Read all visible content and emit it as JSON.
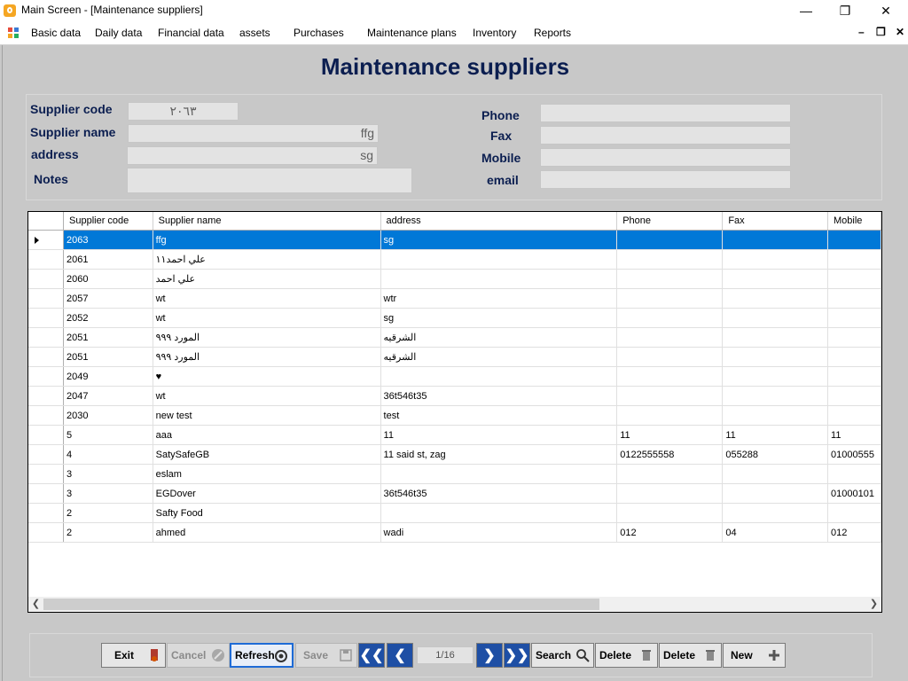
{
  "window": {
    "title": "Main Screen - [Maintenance suppliers]"
  },
  "menu": [
    "Basic data",
    "Daily data",
    "Financial data",
    "assets",
    "Purchases",
    "Maintenance plans",
    "Inventory",
    "Reports"
  ],
  "form": {
    "heading": "Maintenance suppliers",
    "labels": {
      "supplier_code": "Supplier code",
      "supplier_name": "Supplier name",
      "address": "address",
      "notes": "Notes",
      "phone": "Phone",
      "fax": "Fax",
      "mobile": "Mobile",
      "email": "email"
    },
    "values": {
      "supplier_code": "٢٠٦٣",
      "supplier_name": "ffg",
      "address": "sg",
      "notes": "",
      "phone": "",
      "fax": "",
      "mobile": "",
      "email": ""
    }
  },
  "grid": {
    "columns": [
      "Supplier code",
      "Supplier name",
      "address",
      "Phone",
      "Fax",
      "Mobile"
    ],
    "rows": [
      [
        "2063",
        "ffg",
        "sg",
        "",
        "",
        ""
      ],
      [
        "2061",
        "علي احمد١١",
        "",
        "",
        "",
        ""
      ],
      [
        "2060",
        "علي احمد",
        "",
        "",
        "",
        ""
      ],
      [
        "2057",
        "wt",
        "wtr",
        "",
        "",
        ""
      ],
      [
        "2052",
        "wt",
        "sg",
        "",
        "",
        ""
      ],
      [
        "2051",
        "المورد ٩٩٩",
        "الشرقيه",
        "",
        "",
        ""
      ],
      [
        "2051",
        "المورد ٩٩٩",
        "الشرقيه",
        "",
        "",
        ""
      ],
      [
        "2049",
        "♥",
        "",
        "",
        "",
        ""
      ],
      [
        "2047",
        "wt",
        "36t546t35",
        "",
        "",
        ""
      ],
      [
        "2030",
        "new test",
        "test",
        "",
        "",
        ""
      ],
      [
        "5",
        "aaa",
        "11",
        "11",
        "11",
        "11"
      ],
      [
        "4",
        "SatySafeGB",
        "11 said st, zag",
        "0122555558",
        "055288",
        "01000555"
      ],
      [
        "3",
        "eslam",
        "",
        "",
        "",
        ""
      ],
      [
        "3",
        "EGDover",
        "36t546t35",
        "",
        "",
        "01000101"
      ],
      [
        "2",
        "Safty Food",
        "",
        "",
        "",
        ""
      ],
      [
        "2",
        "ahmed",
        "wadi",
        "012",
        "04",
        "012"
      ]
    ]
  },
  "toolbar": {
    "exit": "Exit",
    "cancel": "Cancel",
    "refresh": "Refresh",
    "save": "Save",
    "page": "1/16",
    "search": "Search",
    "delete1": "Delete",
    "delete2": "Delete",
    "new": "New"
  },
  "colors": {
    "heading": "#0b1e50",
    "selection": "#0078d7",
    "nav_button": "#1e4fa5"
  }
}
